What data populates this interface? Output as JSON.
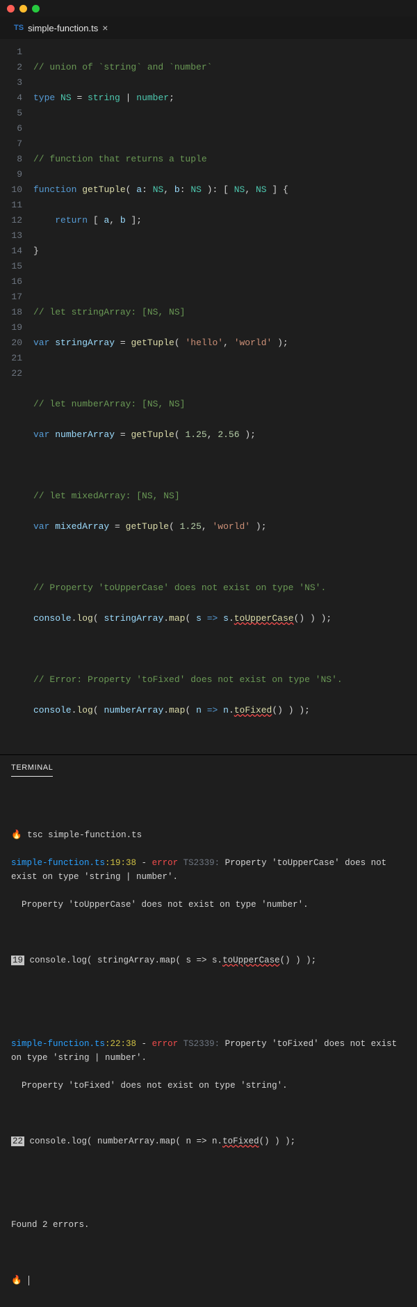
{
  "tab": {
    "icon": "TS",
    "filename": "simple-function.ts",
    "close": "×"
  },
  "lines": {
    "count": 22
  },
  "code": {
    "l1": "// union of `string` and `number`",
    "l2_kw": "type",
    "l2_name": "NS",
    "l2_eq": " = ",
    "l2_t1": "string",
    "l2_pipe": " | ",
    "l2_t2": "number",
    "l2_end": ";",
    "l4": "// function that returns a tuple",
    "l5_kw": "function",
    "l5_fn": "getTuple",
    "l5_p1": "( ",
    "l5_a": "a",
    "l5_c1": ": ",
    "l5_at": "NS",
    "l5_cm": ", ",
    "l5_b": "b",
    "l5_c2": ": ",
    "l5_bt": "NS",
    "l5_p2": " ): [ ",
    "l5_t1": "NS",
    "l5_cm2": ", ",
    "l5_t2": "NS",
    "l5_p3": " ] {",
    "l6_pre": "    ",
    "l6_kw": "return",
    "l6_sp": " [ ",
    "l6_a": "a",
    "l6_cm": ", ",
    "l6_b": "b",
    "l6_end": " ];",
    "l7": "}",
    "l9": "// let stringArray: [NS, NS]",
    "l10_kw": "var",
    "l10_name": "stringArray",
    "l10_eq": " = ",
    "l10_fn": "getTuple",
    "l10_p": "( ",
    "l10_s1": "'hello'",
    "l10_cm": ", ",
    "l10_s2": "'world'",
    "l10_end": " );",
    "l12": "// let numberArray: [NS, NS]",
    "l13_kw": "var",
    "l13_name": "numberArray",
    "l13_eq": " = ",
    "l13_fn": "getTuple",
    "l13_p": "( ",
    "l13_n1": "1.25",
    "l13_cm": ", ",
    "l13_n2": "2.56",
    "l13_end": " );",
    "l15": "// let mixedArray: [NS, NS]",
    "l16_kw": "var",
    "l16_name": "mixedArray",
    "l16_eq": " = ",
    "l16_fn": "getTuple",
    "l16_p": "( ",
    "l16_n1": "1.25",
    "l16_cm": ", ",
    "l16_s2": "'world'",
    "l16_end": " );",
    "l18": "// Property 'toUpperCase' does not exist on type 'NS'.",
    "l19_obj": "console",
    "l19_dot": ".",
    "l19_fn": "log",
    "l19_p1": "( ",
    "l19_arr": "stringArray",
    "l19_dot2": ".",
    "l19_map": "map",
    "l19_p2": "( ",
    "l19_s": "s",
    "l19_arrow": " => ",
    "l19_s2": "s",
    "l19_dot3": ".",
    "l19_err": "toUpperCase",
    "l19_end": "() ) );",
    "l21": "// Error: Property 'toFixed' does not exist on type 'NS'.",
    "l22_obj": "console",
    "l22_dot": ".",
    "l22_fn": "log",
    "l22_p1": "( ",
    "l22_arr": "numberArray",
    "l22_dot2": ".",
    "l22_map": "map",
    "l22_p2": "( ",
    "l22_n": "n",
    "l22_arrow": " => ",
    "l22_n2": "n",
    "l22_dot3": ".",
    "l22_err": "toFixed",
    "l22_end": "() ) );"
  },
  "terminal": {
    "label": "TERMINAL",
    "prompt": "🔥 ",
    "cmd": "tsc simple-function.ts",
    "e1_file": "simple-function.ts",
    "e1_loc": ":19:38",
    "e1_dash": " - ",
    "e1_err": "error",
    "e1_code": " TS2339: ",
    "e1_msg": "Property 'toUpperCase' does not exist on type 'string | number'.",
    "e1_sub": "  Property 'toUpperCase' does not exist on type 'number'.",
    "e1_ln": "19",
    "e1_snippet_pre": " console.log( stringArray.map( s => s.",
    "e1_snippet_err": "toUpperCase",
    "e1_snippet_post": "() ) );",
    "e2_file": "simple-function.ts",
    "e2_loc": ":22:38",
    "e2_dash": " - ",
    "e2_err": "error",
    "e2_code": " TS2339: ",
    "e2_msg": "Property 'toFixed' does not exist on type 'string | number'.",
    "e2_sub": "  Property 'toFixed' does not exist on type 'string'.",
    "e2_ln": "22",
    "e2_snippet_pre": " console.log( numberArray.map( n => n.",
    "e2_snippet_err": "toFixed",
    "e2_snippet_post": "() ) );",
    "summary": "Found 2 errors.",
    "prompt2": "🔥 "
  }
}
